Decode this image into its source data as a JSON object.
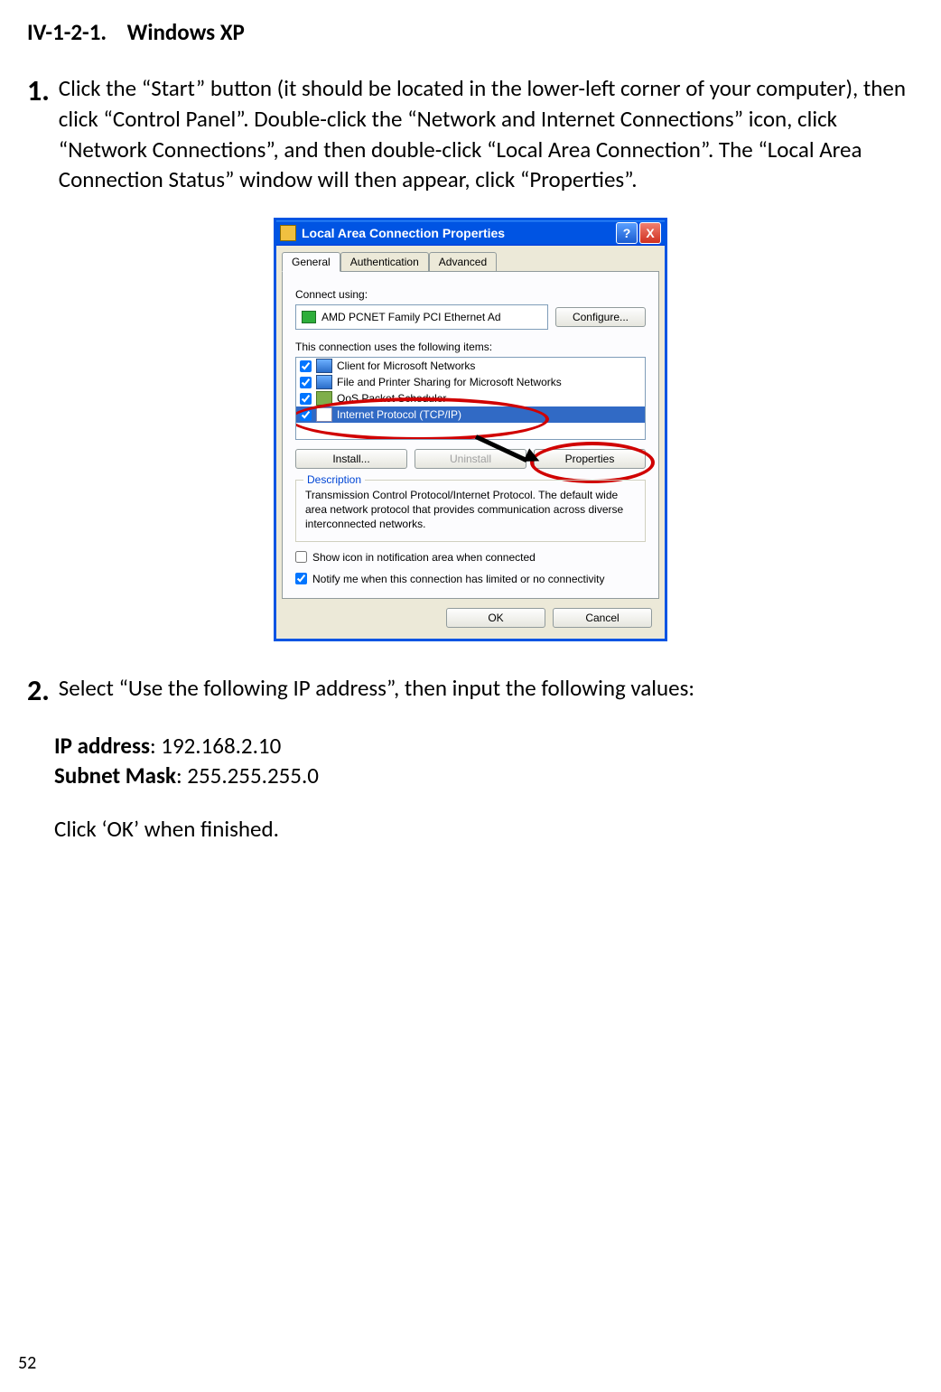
{
  "section": {
    "number": "IV-1-2-1.",
    "title": "Windows XP"
  },
  "step1": {
    "num": "1.",
    "text": "Click the “Start” button (it should be located in the lower-left corner of your computer), then click “Control Panel”. Double-click the “Network and Internet Connections” icon, click “Network Connections”, and then double-click “Local Area Connection”. The “Local Area Connection Status” window will then appear, click “Properties”."
  },
  "dialog": {
    "title": "Local Area Connection Properties",
    "help": "?",
    "close": "X",
    "tabs": {
      "general": "General",
      "auth": "Authentication",
      "advanced": "Advanced"
    },
    "connect_using_label": "Connect using:",
    "adapter": "AMD PCNET Family PCI Ethernet Ad",
    "configure": "Configure...",
    "items_label": "This connection uses the following items:",
    "items": [
      "Client for Microsoft Networks",
      "File and Printer Sharing for Microsoft Networks",
      "QoS Packet Scheduler",
      "Internet Protocol (TCP/IP)"
    ],
    "install": "Install...",
    "uninstall": "Uninstall",
    "properties": "Properties",
    "desc_title": "Description",
    "desc": "Transmission Control Protocol/Internet Protocol. The default wide area network protocol that provides communication across diverse interconnected networks.",
    "show_icon": "Show icon in notification area when connected",
    "notify": "Notify me when this connection has limited or no connectivity",
    "ok": "OK",
    "cancel": "Cancel"
  },
  "step2": {
    "num": "2.",
    "intro": "Select “Use the following IP address”, then input the following values:",
    "ip_label": "IP address",
    "ip_value": ": 192.168.2.10",
    "mask_label": "Subnet Mask",
    "mask_value": ": 255.255.255.0",
    "finish": "Click ‘OK’ when finished."
  },
  "page_number": "52"
}
